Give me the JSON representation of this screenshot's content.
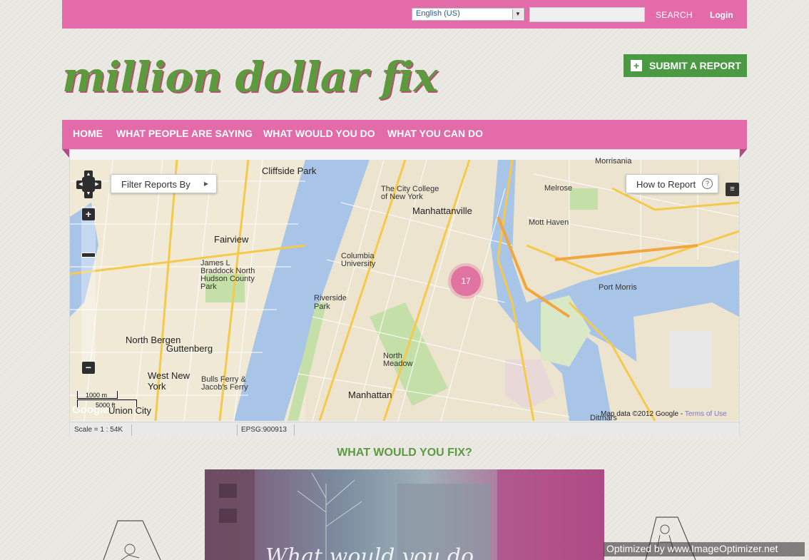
{
  "topbar": {
    "language": "English (US)",
    "search_label": "SEARCH",
    "login_label": "Login"
  },
  "logo_text": "million dollar fix",
  "submit_report_label": "SUBMIT A REPORT",
  "nav": {
    "items": [
      {
        "label": "HOME"
      },
      {
        "label": "WHAT PEOPLE ARE SAYING"
      },
      {
        "label": "WHAT WOULD YOU DO"
      },
      {
        "label": "WHAT YOU CAN DO"
      }
    ]
  },
  "map": {
    "filter_label": "Filter Reports By",
    "how_to_label": "How to Report",
    "cluster_count": "17",
    "scale_m": "1000 m",
    "scale_ft": "5000 ft",
    "attribution": "Map data ©2012 Google -",
    "terms_label": "Terms of Use",
    "google_logo": "Google",
    "labels": {
      "cliffside_park": "Cliffside Park",
      "fairview": "Fairview",
      "braddock": "James L Braddock North Hudson County Park",
      "north_bergen": "North Bergen",
      "guttenberg": "Guttenberg",
      "west_new_york": "West New York",
      "bulls_ferry": "Bulls Ferry & Jacob's Ferry",
      "union_city": "Union City",
      "manhattanville": "Manhattanville",
      "city_college": "The City College of New York",
      "columbia": "Columbia University",
      "riverside_park": "Riverside Park",
      "north_meadow": "North Meadow",
      "manhattan": "Manhattan",
      "melrose": "Melrose",
      "mott_haven": "Mott Haven",
      "port_morris": "Port Morris",
      "morrisania": "Morrisania",
      "ditmars": "Ditmars"
    }
  },
  "scale_row": {
    "scale_text": "Scale = 1 : 54K",
    "epsg_text": "EPSG:900913"
  },
  "section_title": "WHAT WOULD YOU FIX?",
  "video_title": "What would you do",
  "watermark": "Optimized by www.ImageOptimizer.net",
  "colors": {
    "pink": "#e36ba9",
    "green": "#5d9a3e",
    "button_green": "#4c9943"
  }
}
